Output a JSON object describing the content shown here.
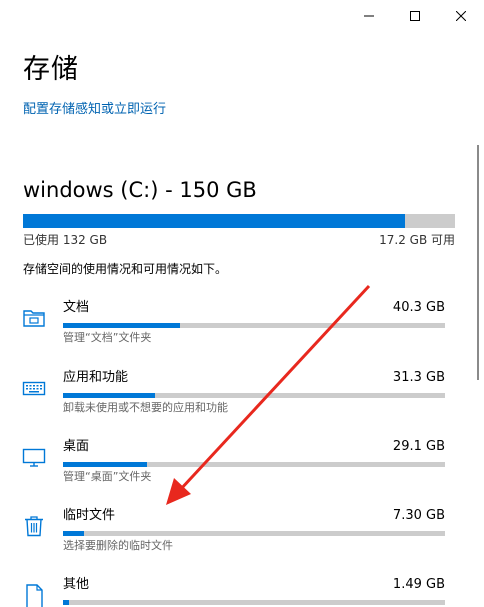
{
  "window": {
    "minimize_icon": "minimize-icon",
    "maximize_icon": "maximize-icon",
    "close_icon": "close-icon"
  },
  "page": {
    "title": "存储",
    "storage_sense_link": "配置存储感知或立即运行"
  },
  "drive": {
    "title": "windows (C:) - 150 GB",
    "used_label": "已使用 132 GB",
    "free_label": "17.2 GB 可用",
    "used_fraction": 0.885,
    "description": "存储空间的使用情况和可用情况如下。"
  },
  "categories": [
    {
      "name": "文档",
      "size": "40.3 GB",
      "sub": "管理“文档”文件夹",
      "icon": "folder-icon",
      "fraction": 0.305
    },
    {
      "name": "应用和功能",
      "size": "31.3 GB",
      "sub": "卸载未使用或不想要的应用和功能",
      "icon": "keyboard-icon",
      "fraction": 0.24
    },
    {
      "name": "桌面",
      "size": "29.1 GB",
      "sub": "管理“桌面”文件夹",
      "icon": "monitor-icon",
      "fraction": 0.22
    },
    {
      "name": "临时文件",
      "size": "7.30 GB",
      "sub": "选择要删除的临时文件",
      "icon": "trash-icon",
      "fraction": 0.055
    },
    {
      "name": "其他",
      "size": "1.49 GB",
      "sub": "",
      "icon": "document-icon",
      "fraction": 0.015
    }
  ],
  "colors": {
    "accent": "#0078d7",
    "link": "#0063b1",
    "bar_bg": "#cccccc",
    "annotation_arrow": "#e8281e"
  }
}
